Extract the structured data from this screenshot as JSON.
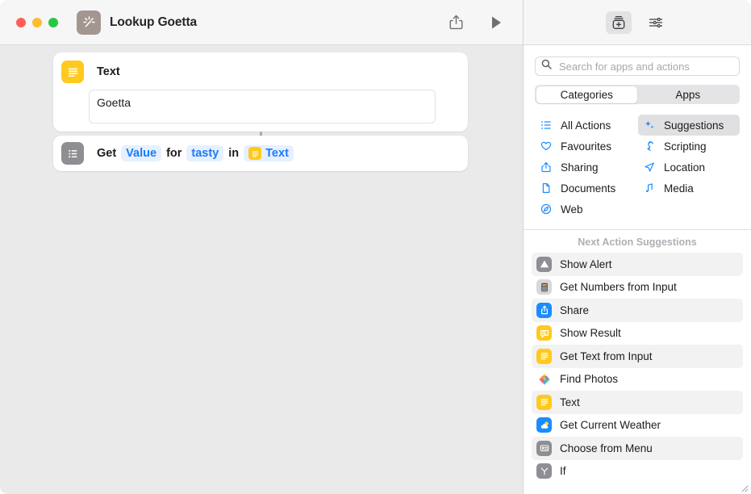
{
  "window": {
    "title": "Lookup Goetta",
    "app_icon": "shortcuts-wand-icon",
    "traffic_lights": [
      "close",
      "minimize",
      "zoom"
    ],
    "share_button": "share-icon",
    "run_button": "play-icon"
  },
  "canvas": {
    "actions": [
      {
        "icon": "text-lines-icon",
        "icon_color": "#ffc91e",
        "title": "Text",
        "field_value": "Goetta"
      },
      {
        "icon": "dictionary-list-icon",
        "icon_color": "#8e8e93",
        "parts": [
          {
            "type": "plain",
            "text": "Get"
          },
          {
            "type": "token",
            "text": "Value"
          },
          {
            "type": "plain",
            "text": "for"
          },
          {
            "type": "token",
            "text": "tasty"
          },
          {
            "type": "plain",
            "text": "in"
          },
          {
            "type": "token",
            "text": "Text",
            "has_icon": true
          }
        ]
      }
    ]
  },
  "sidebar": {
    "toolbar": [
      {
        "name": "add-action-icon",
        "label": "Action Library",
        "selected": true
      },
      {
        "name": "sliders-icon",
        "label": "Shortcut Details",
        "selected": false
      }
    ],
    "search": {
      "placeholder": "Search for apps and actions",
      "value": "",
      "icon": "search-icon"
    },
    "segments": [
      {
        "label": "Categories",
        "selected": true
      },
      {
        "label": "Apps",
        "selected": false
      }
    ],
    "categories": [
      {
        "label": "All Actions",
        "icon": "list-bullets-icon",
        "selected": false
      },
      {
        "label": "Suggestions",
        "icon": "sparkles-icon",
        "selected": true
      },
      {
        "label": "Favourites",
        "icon": "heart-icon",
        "selected": false
      },
      {
        "label": "Scripting",
        "icon": "script-icon",
        "selected": false
      },
      {
        "label": "Sharing",
        "icon": "share-icon",
        "selected": false
      },
      {
        "label": "Location",
        "icon": "location-arrow-icon",
        "selected": false
      },
      {
        "label": "Documents",
        "icon": "document-icon",
        "selected": false
      },
      {
        "label": "Media",
        "icon": "music-note-icon",
        "selected": false
      },
      {
        "label": "Web",
        "icon": "compass-icon",
        "selected": false
      }
    ],
    "suggestions_header": "Next Action Suggestions",
    "suggestions": [
      {
        "label": "Show Alert",
        "icon": "alert-triangle-icon",
        "color": "#8e8e93"
      },
      {
        "label": "Get Numbers from Input",
        "icon": "calculator-icon",
        "color": "#d8d8dc"
      },
      {
        "label": "Share",
        "icon": "share-box-icon",
        "color": "#1a8cff"
      },
      {
        "label": "Show Result",
        "icon": "speech-bubble-icon",
        "color": "#ffc91e"
      },
      {
        "label": "Get Text from Input",
        "icon": "text-lines-icon",
        "color": "#ffc91e"
      },
      {
        "label": "Find Photos",
        "icon": "photos-pinwheel-icon",
        "color": "#ffffff"
      },
      {
        "label": "Text",
        "icon": "text-lines-icon",
        "color": "#ffc91e"
      },
      {
        "label": "Get Current Weather",
        "icon": "weather-sun-cloud-icon",
        "color": "#1a8cff"
      },
      {
        "label": "Choose from Menu",
        "icon": "menu-card-icon",
        "color": "#8e8e93"
      },
      {
        "label": "If",
        "icon": "branch-icon",
        "color": "#8e8e93"
      }
    ]
  },
  "colors": {
    "accent_blue": "#1a7cfb",
    "canvas_bg": "#eaeaea",
    "yellow": "#ffc91e",
    "gray": "#8e8e93"
  }
}
